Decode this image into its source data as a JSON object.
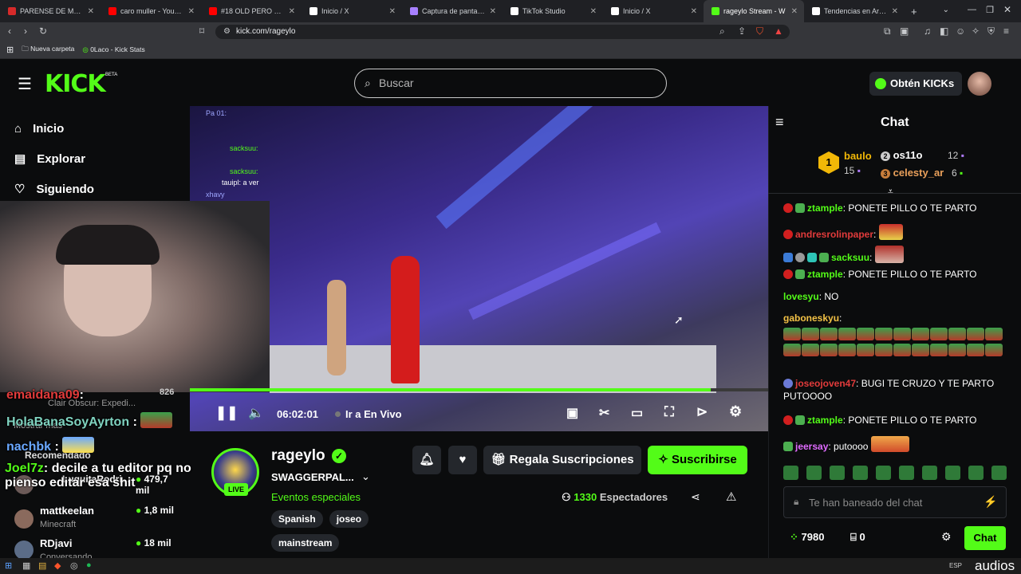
{
  "browser": {
    "tabs": [
      {
        "title": "PARENSE DE MANOS 3 - E",
        "color": "#d62a2a"
      },
      {
        "title": "caro muller - YouTube",
        "color": "#ff0000"
      },
      {
        "title": "#18 OLD PERO GOLD - Yo",
        "color": "#ff0000"
      },
      {
        "title": "Inicio / X",
        "color": "#ffffff"
      },
      {
        "title": "Captura de pantalla por Lu",
        "color": "#a780ff"
      },
      {
        "title": "TikTok Studio",
        "color": "#ffffff"
      },
      {
        "title": "Inicio / X",
        "color": "#ffffff"
      },
      {
        "title": "rageylo Stream - W",
        "color": "#53fc18",
        "active": true
      },
      {
        "title": "Tendencias en Argentina",
        "color": "#ffffff"
      }
    ],
    "url": "kick.com/rageylo",
    "bookmarks": [
      "Nueva carpeta",
      "0Laco - Kick Stats"
    ]
  },
  "header": {
    "logo": "KICK",
    "beta": "BETA",
    "search_placeholder": "Buscar",
    "kicks_button": "Obtén KICKs"
  },
  "nav": {
    "items": [
      "Inicio",
      "Explorar",
      "Siguiendo"
    ]
  },
  "sidebar": {
    "recommended_label": "Recomendado",
    "show_more": "Mostrar más",
    "overlay_partial": [
      "Clair Obscur: Expedi...",
      "826"
    ],
    "channels": [
      {
        "name": "LuquitaRodri...",
        "game": "",
        "viewers": "479,7 mil"
      },
      {
        "name": "mattkeelan",
        "game": "Minecraft",
        "viewers": "1,8 mil"
      },
      {
        "name": "RDjavi",
        "game": "Conversando",
        "viewers": "18 mil"
      }
    ]
  },
  "overlay_chat": [
    {
      "user": "emaidana09",
      "text": ":",
      "color": "#e23b3b"
    },
    {
      "user": "HolaBanaSoyAyrton",
      "text": ":",
      "color": "#7fd3c0"
    },
    {
      "user": "nachbk",
      "text": ":",
      "color": "#6aa8ff"
    },
    {
      "user": "Joel7z",
      "text": ": decile a tu editor pq no pienso editar esa shit",
      "color": "#53fc18"
    }
  ],
  "video_overlay": {
    "users": [
      "Pa 01:",
      "sacksuu:",
      "sacksuu:",
      "tauipl: a ver",
      "xhavy"
    ]
  },
  "player": {
    "time": "06:02:01",
    "live_label": "Ir a En Vivo",
    "progress": 0.9
  },
  "streamer": {
    "name": "rageylo",
    "title": "SWAGGERPAL...",
    "category": "Eventos especiales",
    "live": "LIVE",
    "tags": [
      "Spanish",
      "joseo",
      "mainstream"
    ],
    "viewers": "1330",
    "viewers_label": "Espectadores",
    "gift_button": "Regala Suscripciones",
    "subscribe_button": "Suscribirse"
  },
  "chat": {
    "title": "Chat",
    "leaderboard": [
      {
        "rank": "1",
        "name": "baulo",
        "count": "15"
      },
      {
        "rank": "2",
        "name": "os11o",
        "count": "12"
      },
      {
        "rank": "3",
        "name": "celesty_ar",
        "count": "6"
      }
    ],
    "messages": [
      {
        "user": "ztample",
        "color": "#53fc18",
        "text": ": PONETE PILLO O TE PARTO"
      },
      {
        "user": "andresrolinpaper",
        "color": "#e23b3b",
        "text": ":"
      },
      {
        "user": "sacksuu",
        "color": "#53fc18",
        "text": ":"
      },
      {
        "user": "ztample",
        "color": "#53fc18",
        "text": ": PONETE PILLO O TE PARTO"
      },
      {
        "user": "lovesyu",
        "color": "#53fc18",
        "text": ": NO"
      },
      {
        "user": "gaboneskyu",
        "color": "#f3c246",
        "text": ":"
      },
      {
        "user": "joseojoven47",
        "color": "#e23b3b",
        "text": ": BUGI TE CRUZO Y TE PARTO PUTOOOO"
      },
      {
        "user": "ztample",
        "color": "#53fc18",
        "text": ": PONETE PILLO O TE PARTO"
      },
      {
        "user": "jeersay",
        "color": "#e06bff",
        "text": ": putoooo"
      }
    ],
    "input_placeholder": "Te han baneado del chat",
    "points": "7980",
    "drops": "0",
    "send_button": "Chat"
  },
  "taskbar": {
    "lang": "ESP",
    "corner": "audios"
  }
}
